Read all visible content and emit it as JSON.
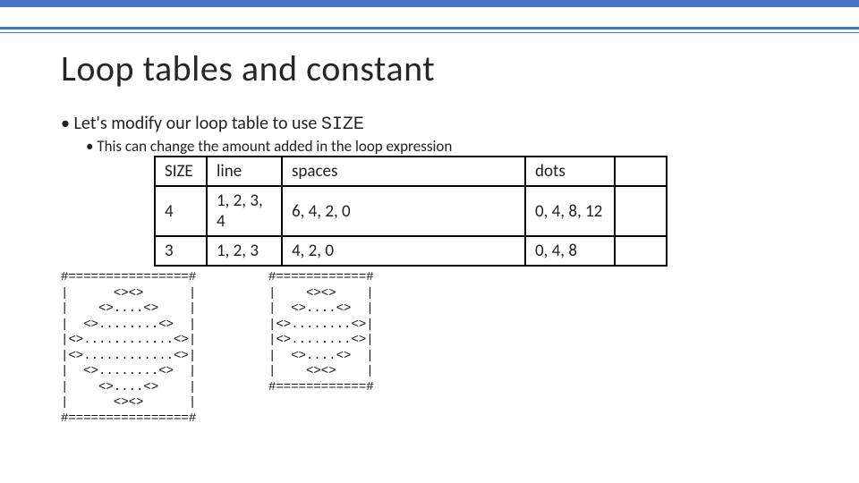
{
  "title": "Loop tables and constant",
  "bullets": {
    "lvl1_a": "Let's modify our loop table to use ",
    "lvl1_a_code": "SIZE",
    "lvl2_a": "This can change the amount added in the loop expression"
  },
  "table": {
    "headers": {
      "size": "SIZE",
      "line": "line",
      "spaces": "spaces",
      "dots": "dots",
      "end": ""
    },
    "rows": [
      {
        "size": "4",
        "line": "1, 2, 3, 4",
        "spaces": "6, 4, 2, 0",
        "dots": "0, 4, 8, 12",
        "end": ""
      },
      {
        "size": "3",
        "line": "1, 2, 3",
        "spaces": "4, 2, 0",
        "dots": "0, 4, 8",
        "end": ""
      }
    ]
  },
  "ascii_left": "#================#\n|      <><>      |\n|    <>....<>    |\n|  <>........<>  |\n|<>............<>|\n|<>............<>|\n|  <>........<>  |\n|    <>....<>    |\n|      <><>      |\n#================#",
  "ascii_right": "#============#\n|    <><>    |\n|  <>....<>  |\n|<>........<>|\n|<>........<>|\n|  <>....<>  |\n|    <><>    |\n#============#"
}
